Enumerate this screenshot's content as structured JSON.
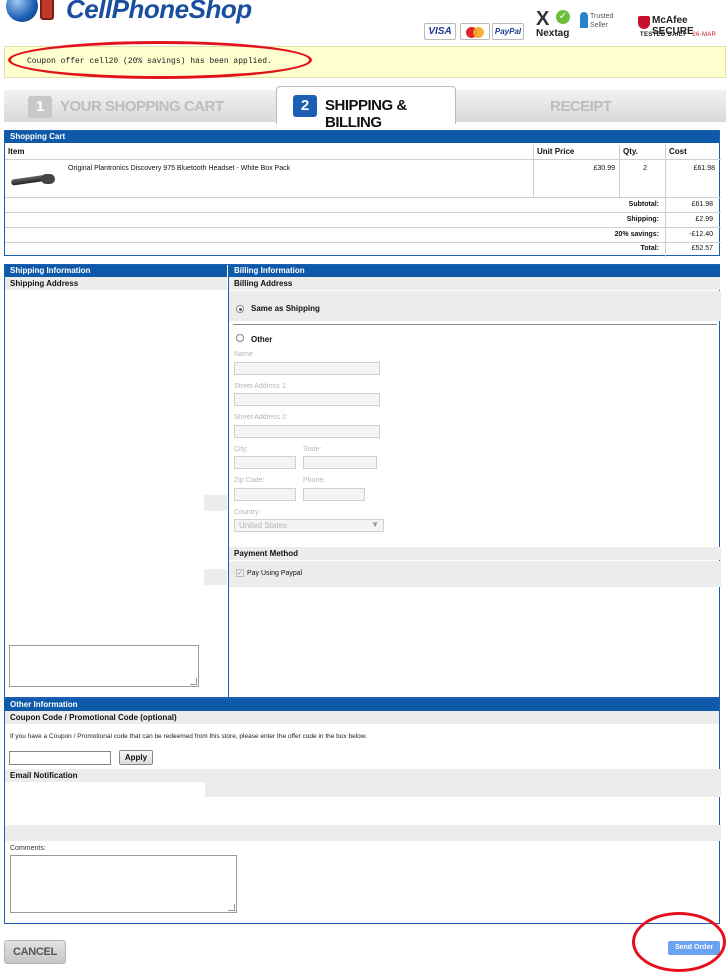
{
  "header": {
    "logo_text": "CellPhoneShop",
    "payment_icons": [
      "VISA",
      "MasterCard",
      "PayPal"
    ],
    "nextag_label": "Nextag",
    "trusted_seller": "Trusted Seller",
    "mcafee_label": "McAfee SECURE",
    "mcafee_tested": "TESTED DAILY",
    "mcafee_date": "26-MAR"
  },
  "coupon_message": "Coupon offer cell20 (20% savings) has been applied.",
  "steps": [
    {
      "number": "1",
      "label": "YOUR SHOPPING CART",
      "state": "inactive"
    },
    {
      "number": "2",
      "label": "SHIPPING & BILLING",
      "state": "active"
    },
    {
      "number": "",
      "label": "RECEIPT",
      "state": "inactive"
    }
  ],
  "cart": {
    "title": "Shopping Cart",
    "columns": {
      "item": "Item",
      "unit_price": "Unit Price",
      "qty": "Qty.",
      "cost": "Cost"
    },
    "items": [
      {
        "name": "Original Plantronics Discovery 975 Bluetooth Headset - White Box Pack",
        "unit_price": "£30.99",
        "qty": "2",
        "cost": "£61.98"
      }
    ],
    "summary": [
      {
        "label": "Subtotal:",
        "value": "£61.98"
      },
      {
        "label": "Shipping:",
        "value": "£2.99"
      },
      {
        "label": "20% savings:",
        "value": "-£12.40"
      },
      {
        "label": "Total:",
        "value": "£52.57"
      }
    ]
  },
  "shipping": {
    "title": "Shipping Information",
    "address_label": "Shipping Address"
  },
  "billing": {
    "title": "Billing Information",
    "address_label": "Billing Address",
    "same_as_shipping": "Same as Shipping",
    "other": "Other",
    "fields": {
      "name": "Name:",
      "street1": "Street Address 1:",
      "street2": "Street Address 2:",
      "city": "City:",
      "state": "State:",
      "zip": "Zip Code:",
      "phone": "Phone:",
      "country": "Country:",
      "country_value": "United States"
    },
    "payment_method_label": "Payment Method",
    "pay_paypal": "Pay Using Paypal"
  },
  "other_info": {
    "title": "Other Information",
    "coupon_label": "Coupon Code / Promotional Code (optional)",
    "coupon_desc": "If you have a Coupon / Promotional code that can be redeemed from this store, please enter the offer code in the box below.",
    "apply_button": "Apply",
    "email_label": "Email Notification",
    "comments_label": "Comments:"
  },
  "buttons": {
    "cancel": "CANCEL",
    "send_order": "Send Order"
  },
  "colors": {
    "accent_blue": "#0f5aa8",
    "highlight_red": "#e3111c",
    "message_bg": "#ffffcf"
  }
}
